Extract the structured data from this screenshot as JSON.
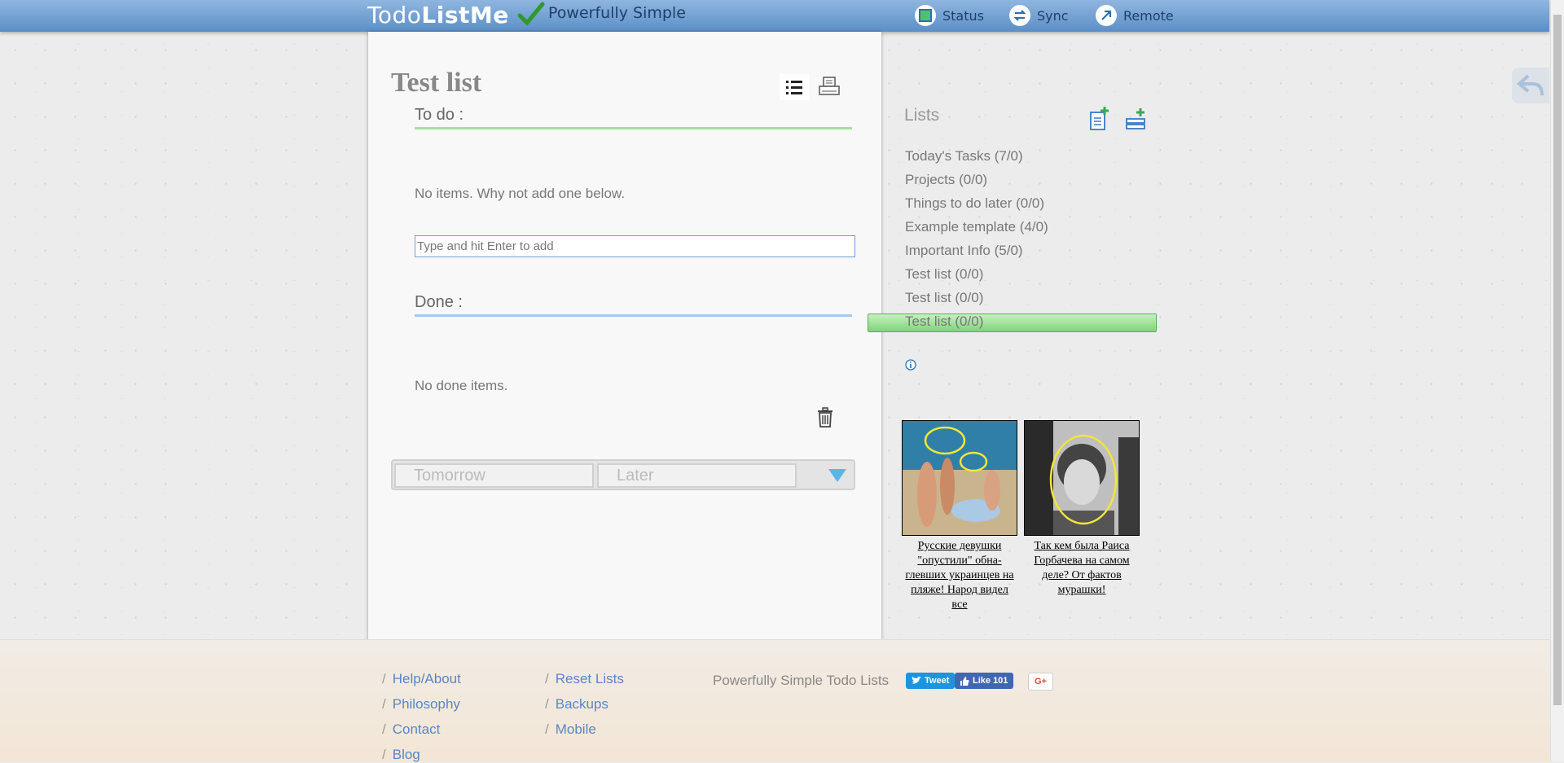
{
  "header": {
    "logo_part1": "Todo",
    "logo_part2": "ListMe",
    "tagline": "Powerfully Simple",
    "nav": [
      {
        "label": "Status",
        "icon": "status-icon"
      },
      {
        "label": "Sync",
        "icon": "sync-icon"
      },
      {
        "label": "Remote",
        "icon": "remote-icon"
      }
    ]
  },
  "main": {
    "title": "Test list",
    "todo_heading": "To do :",
    "todo_empty": "No items. Why not add one below.",
    "add_placeholder": "Type and hit Enter to add",
    "done_heading": "Done :",
    "done_empty": "No done items.",
    "schedule": {
      "tomorrow": "Tomorrow",
      "later": "Later"
    }
  },
  "sidebar": {
    "heading": "Lists",
    "lists": [
      "Today's Tasks (7/0)",
      "Projects (0/0)",
      "Things to do later (0/0)",
      "Example template (4/0)",
      "Important Info (5/0)",
      "Test list (0/0)",
      "Test list (0/0)",
      "Test list (0/0)"
    ],
    "active_index": 7
  },
  "ads": [
    {
      "caption": "Русские девушки \"опустили\" обна-глевших украинцев на пляже! Народ видел все"
    },
    {
      "caption": "Так кем была Раиса Горбачева на самом деле? От фактов мурашки!"
    }
  ],
  "footer": {
    "col1": [
      "Help/About",
      "Philosophy",
      "Contact",
      "Blog"
    ],
    "col2": [
      "Reset Lists",
      "Backups",
      "Mobile"
    ],
    "tagline": "Powerfully Simple Todo Lists",
    "tweet": "Tweet",
    "like": "Like 101",
    "gplus": "G+"
  },
  "colors": {
    "header": "#5b8fc7",
    "todo_line": "#a6e0a0",
    "done_line": "#a9c8e8",
    "active_list": "#7fd47a"
  }
}
